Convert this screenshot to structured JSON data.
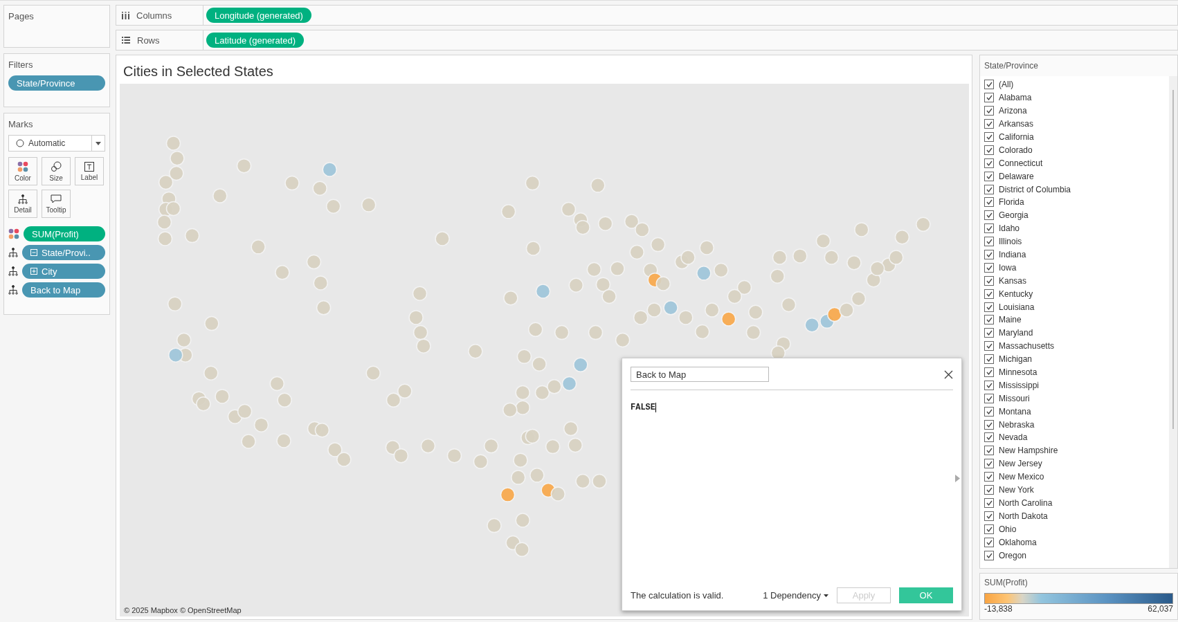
{
  "pages_card": {
    "title": "Pages"
  },
  "filters_card": {
    "title": "Filters",
    "pills": [
      {
        "label": "State/Province"
      }
    ]
  },
  "marks_card": {
    "title": "Marks",
    "mark_type": "Automatic",
    "buttons": [
      {
        "kind": "color",
        "label": "Color"
      },
      {
        "kind": "size",
        "label": "Size"
      },
      {
        "kind": "label",
        "label": "Label"
      },
      {
        "kind": "detail",
        "label": "Detail"
      },
      {
        "kind": "tooltip",
        "label": "Tooltip"
      }
    ],
    "fields": [
      {
        "kind": "color",
        "label": "SUM(Profit)",
        "measure": true
      },
      {
        "kind": "detail",
        "label": "State/Provi..",
        "expanded": true,
        "measure": false
      },
      {
        "kind": "detail",
        "label": "City",
        "expanded": false,
        "measure": false
      },
      {
        "kind": "detail",
        "label": "Back to Map",
        "measure": false
      }
    ]
  },
  "shelves": [
    {
      "kind": "columns",
      "label": "Columns",
      "pill": "Longitude (generated)"
    },
    {
      "kind": "rows",
      "label": "Rows",
      "pill": "Latitude (generated)"
    }
  ],
  "view": {
    "title": "Cities in Selected States",
    "attribution": "© 2025 Mapbox © OpenStreetMap"
  },
  "calc_dialog": {
    "name": "Back to Map",
    "formula": "FALSE",
    "status": "The calculation is valid.",
    "dependency": "1 Dependency",
    "buttons": [
      {
        "label": "Apply",
        "disabled": true
      },
      {
        "label": "OK",
        "disabled": false
      }
    ]
  },
  "filter_card": {
    "title": "State/Province",
    "items": [
      {
        "label": "(All)",
        "checked": true
      },
      {
        "label": "Alabama",
        "checked": true
      },
      {
        "label": "Arizona",
        "checked": true
      },
      {
        "label": "Arkansas",
        "checked": true
      },
      {
        "label": "California",
        "checked": true
      },
      {
        "label": "Colorado",
        "checked": true
      },
      {
        "label": "Connecticut",
        "checked": true
      },
      {
        "label": "Delaware",
        "checked": true
      },
      {
        "label": "District of Columbia",
        "checked": true
      },
      {
        "label": "Florida",
        "checked": true
      },
      {
        "label": "Georgia",
        "checked": true
      },
      {
        "label": "Idaho",
        "checked": true
      },
      {
        "label": "Illinois",
        "checked": true
      },
      {
        "label": "Indiana",
        "checked": true
      },
      {
        "label": "Iowa",
        "checked": true
      },
      {
        "label": "Kansas",
        "checked": true
      },
      {
        "label": "Kentucky",
        "checked": true
      },
      {
        "label": "Louisiana",
        "checked": true
      },
      {
        "label": "Maine",
        "checked": true
      },
      {
        "label": "Maryland",
        "checked": true
      },
      {
        "label": "Massachusetts",
        "checked": true
      },
      {
        "label": "Michigan",
        "checked": true
      },
      {
        "label": "Minnesota",
        "checked": true
      },
      {
        "label": "Mississippi",
        "checked": true
      },
      {
        "label": "Missouri",
        "checked": true
      },
      {
        "label": "Montana",
        "checked": true
      },
      {
        "label": "Nebraska",
        "checked": true
      },
      {
        "label": "Nevada",
        "checked": true
      },
      {
        "label": "New Hampshire",
        "checked": true
      },
      {
        "label": "New Jersey",
        "checked": true
      },
      {
        "label": "New Mexico",
        "checked": true
      },
      {
        "label": "New York",
        "checked": true
      },
      {
        "label": "North Carolina",
        "checked": true
      },
      {
        "label": "North Dakota",
        "checked": true
      },
      {
        "label": "Ohio",
        "checked": true
      },
      {
        "label": "Oklahoma",
        "checked": true
      },
      {
        "label": "Oregon",
        "checked": true
      }
    ]
  },
  "legend": {
    "title": "SUM(Profit)",
    "min_label": "-13,838",
    "max_label": "62,037"
  }
}
